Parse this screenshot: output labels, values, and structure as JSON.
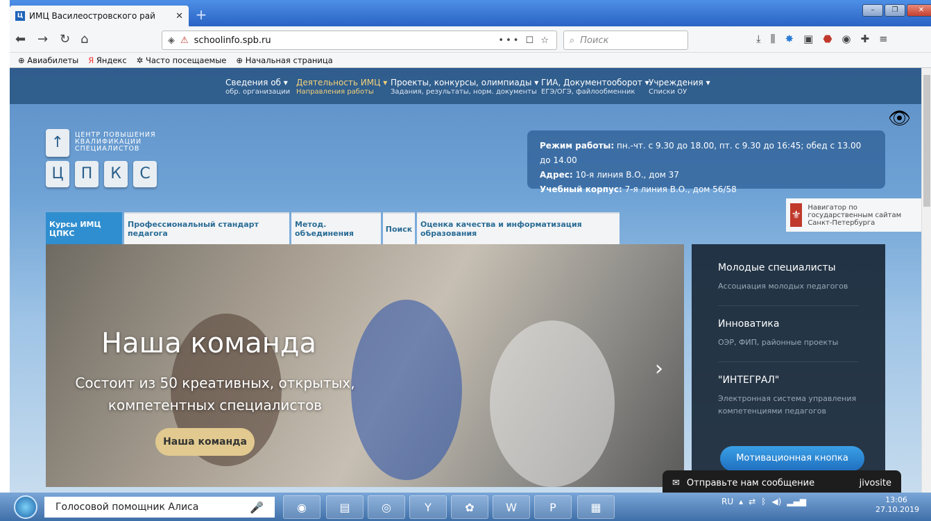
{
  "browser": {
    "tab_title": "ИМЦ Василеостровского рай",
    "tab_favicon": "Ц",
    "url": "schoolinfo.spb.ru",
    "search_placeholder": "Поиск",
    "url_actions": "••• ☐ ☆"
  },
  "bookmarks": [
    {
      "label": "Авиабилеты"
    },
    {
      "label": "Яндекс"
    },
    {
      "label": "Часто посещаемые"
    },
    {
      "label": "Начальная страница"
    }
  ],
  "site_nav": [
    {
      "main": "Сведения об ▾",
      "sub": "обр. организации"
    },
    {
      "main": "Деятельность ИМЦ ▾",
      "sub": "Направления работы"
    },
    {
      "main": "Проекты, конкурсы, олимпиады ▾",
      "sub": "Задания, результаты, норм. документы"
    },
    {
      "main": "ГИА, Документооборот ▾",
      "sub": "ЕГЭ/ОГЭ, файлообменник"
    },
    {
      "main": "Учреждения ▾",
      "sub": "Списки ОУ"
    }
  ],
  "logo": {
    "line1": "ЦЕНТР ПОВЫШЕНИЯ",
    "line2": "КВАЛИФИКАЦИИ",
    "line3": "СПЕЦИАЛИСТОВ",
    "letters": [
      "Ц",
      "П",
      "К",
      "С"
    ]
  },
  "info": {
    "hours_label": "Режим работы:",
    "hours_value": " пн.-чт. с 9.30 до 18.00, пт. с 9.30 до 16:45; обед с 13.00 до 14.00",
    "address_label": "Адрес:",
    "address_value": " 10-я линия В.О., дом 37",
    "campus_label": "Учебный корпус:",
    "campus_value": "  7-я линия В.О., дом 56/58"
  },
  "navigator": {
    "text": "Навигатор по государственным сайтам Санкт-Петербурга"
  },
  "tabs": [
    {
      "label": "Курсы ИМЦ ЦПКС"
    },
    {
      "label": "Профессиональный стандарт педагога"
    },
    {
      "label": "Метод. объединения"
    },
    {
      "label": "Поиск"
    },
    {
      "label": "Оценка качества и информатизация образования"
    }
  ],
  "hero": {
    "title": "Наша команда",
    "subtitle": "Состоит из 50 креативных, открытых, компетентных специалистов",
    "button": "Наша команда"
  },
  "right_panel": [
    {
      "title": "Молодые специалисты",
      "sub": "Ассоциация молодых педагогов"
    },
    {
      "title": "Инноватика",
      "sub": "ОЭР, ФИП, районные проекты"
    },
    {
      "title": "\"ИНТЕГРАЛ\"",
      "sub": "Электронная система управления компетенциями педагогов"
    }
  ],
  "motivation_button": "Мотивационная кнопка",
  "jivo": {
    "text": "Отправьте нам сообщение",
    "brand": "jivosite"
  },
  "taskbar": {
    "assistant": "Голосовой помощник Алиса",
    "lang": "RU",
    "time": "13:06",
    "date": "27.10.2019"
  },
  "colors": {
    "accent": "#2f8ecf",
    "nav_bg": "#285582",
    "highlight": "#f3d27a"
  }
}
